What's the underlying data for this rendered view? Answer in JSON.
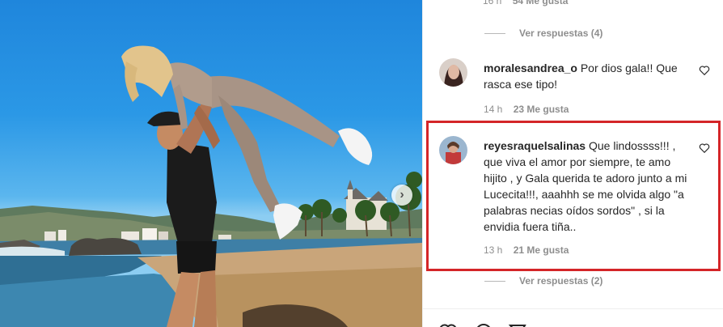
{
  "photo": {
    "alt": "",
    "next_icon": "chevron-right-icon"
  },
  "comments_panel": {
    "top_meta": {
      "time": "16 h",
      "likes": "54 Me gusta"
    },
    "view_replies_1": "Ver respuestas (4)",
    "comments": [
      {
        "username": "moralesandrea_o",
        "text": "Por dios gala!! Que rasca ese tipo!",
        "time": "14 h",
        "likes": "23 Me gusta"
      },
      {
        "username": "reyesraquelsalinas",
        "text": "Que lindossss!!! , que viva el amor por siempre, te amo hijito , y Gala querida te adoro junto a mi Lucecita!!!, aaahhh se me olvida algo \"a palabras necias oídos sordos\" , si la envidia fuera tiña..",
        "time": "13 h",
        "likes": "21 Me gusta"
      }
    ],
    "view_replies_2": "Ver respuestas (2)"
  },
  "colors": {
    "highlight": "#d42528",
    "meta_text": "#8e8e8e",
    "body_text": "#262626"
  }
}
